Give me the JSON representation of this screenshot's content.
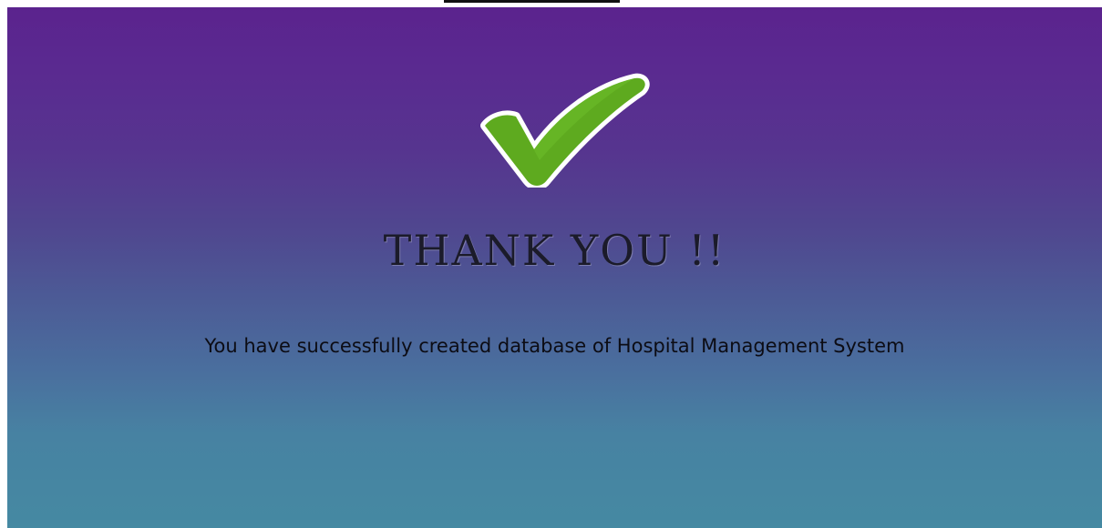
{
  "page": {
    "title": "THANK YOU !!",
    "message": "You have successfully created database of Hospital Management System"
  },
  "icons": {
    "success": "checkmark-icon"
  },
  "colors": {
    "gradient_top": "#5b238e",
    "gradient_bottom": "#4589a2",
    "check_fill": "#5eaa1f",
    "check_outline": "#ffffff"
  }
}
